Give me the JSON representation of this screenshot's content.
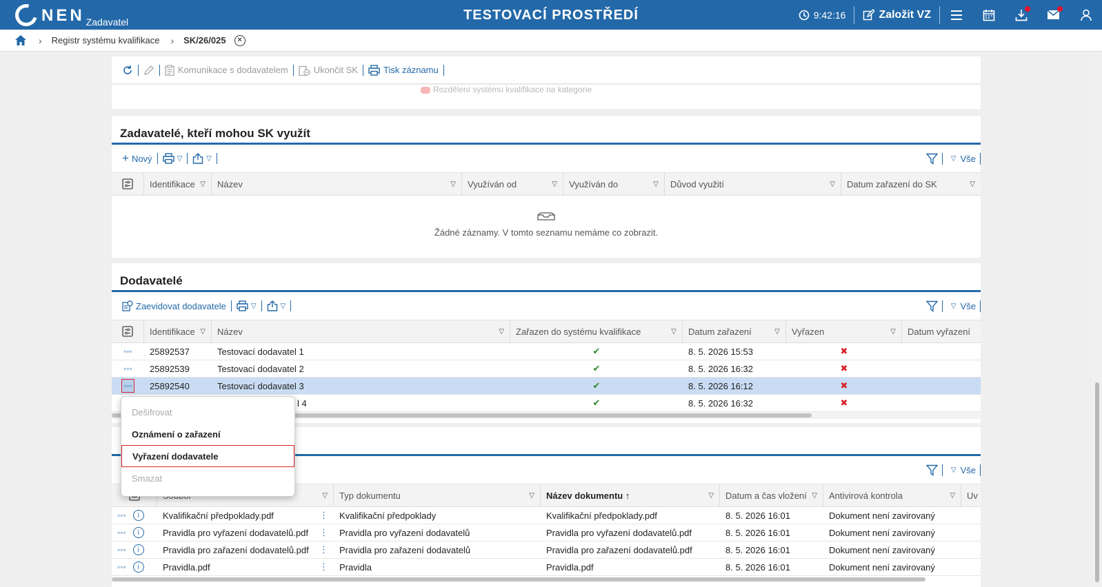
{
  "header": {
    "logo_text": "NEN",
    "logo_sub": "Zadavatel",
    "env_title": "TESTOVACÍ PROSTŘEDÍ",
    "time": "9:42:16",
    "create_label": "Založit VZ"
  },
  "breadcrumb": {
    "item1": "Registr systému kvalifikace",
    "current": "SK/26/025"
  },
  "toolbar": {
    "communication": "Komunikace s dodavatelem",
    "end": "Ukončit SK",
    "print": "Tisk záznamu"
  },
  "ghost_text": "Rozdělení systému kvalifikace na kategorie",
  "contracting": {
    "title": "Zadavatelé, kteří mohou SK využít",
    "new_label": "Nový",
    "all_label": "Vše",
    "columns": [
      "Identifikace",
      "Název",
      "Využíván od",
      "Využíván do",
      "Důvod využití",
      "Datum zařazení do SK"
    ],
    "empty_text": "Žádné záznamy. V tomto seznamu nemáme co zobrazit."
  },
  "suppliers": {
    "title": "Dodavatelé",
    "register_label": "Zaevidovat dodavatele",
    "all_label": "Vše",
    "columns": [
      "Identifikace",
      "Název",
      "Zařazen do systému kvalifikace",
      "Datum zařazení",
      "Vyřazen",
      "Datum vyřazení"
    ],
    "rows": [
      {
        "id": "25892537",
        "name": "Testovací dodavatel 1",
        "date": "8. 5. 2026 15:53"
      },
      {
        "id": "25892539",
        "name": "Testovací dodavatel 2",
        "date": "8. 5. 2026 16:32"
      },
      {
        "id": "25892540",
        "name": "Testovací dodavatel 3",
        "date": "8. 5. 2026 16:12"
      },
      {
        "id": "",
        "name": "l 4",
        "date": "8. 5. 2026 16:32"
      }
    ]
  },
  "context_menu": {
    "decrypt": "Dešifrovat",
    "notice": "Oznámení o zařazení",
    "remove": "Vyřazení dodavatele",
    "delete": "Smazat"
  },
  "documents": {
    "all_label": "Vše",
    "columns": [
      "Soubor",
      "Typ dokumentu",
      "Název dokumentu",
      "Datum a čas vložení",
      "Antivirová kontrola",
      "Uv"
    ],
    "rows": [
      {
        "file": "Kvalifikační předpoklady.pdf",
        "type": "Kvalifikační předpoklady",
        "name": "Kvalifikační předpoklady.pdf",
        "date": "8. 5. 2026 16:01",
        "av": "Dokument není zavirovaný"
      },
      {
        "file": "Pravidla pro vyřazení dodavatelů.pdf",
        "type": "Pravidla pro vyřazení dodavatelů",
        "name": "Pravidla pro vyřazení dodavatelů.pdf",
        "date": "8. 5. 2026 16:01",
        "av": "Dokument není zavirovaný"
      },
      {
        "file": "Pravidla pro zařazení dodavatelů.pdf",
        "type": "Pravidla pro zařazení dodavatelů",
        "name": "Pravidla pro zařazení dodavatelů.pdf",
        "date": "8. 5. 2026 16:01",
        "av": "Dokument není zavirovaný"
      },
      {
        "file": "Pravidla.pdf",
        "type": "Pravidla",
        "name": "Pravidla.pdf",
        "date": "8. 5. 2026 16:01",
        "av": "Dokument není zavirovaný"
      }
    ]
  },
  "colors": {
    "primary": "#2369a9",
    "selected_row": "#c9dcf3",
    "ok": "#2e8b2e",
    "no": "#d8232a"
  }
}
